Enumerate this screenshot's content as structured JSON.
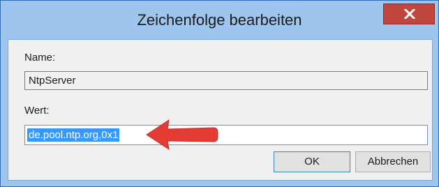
{
  "window": {
    "title": "Zeichenfolge bearbeiten",
    "close_icon": "close-icon"
  },
  "form": {
    "name_label": "Name:",
    "name_value": "NtpServer",
    "value_label": "Wert:",
    "value_text": "de.pool.ntp.org,0x1"
  },
  "buttons": {
    "ok": "OK",
    "cancel": "Abbrechen"
  },
  "annotation": {
    "arrow_icon": "red-arrow-icon",
    "color": "#e53b35"
  }
}
